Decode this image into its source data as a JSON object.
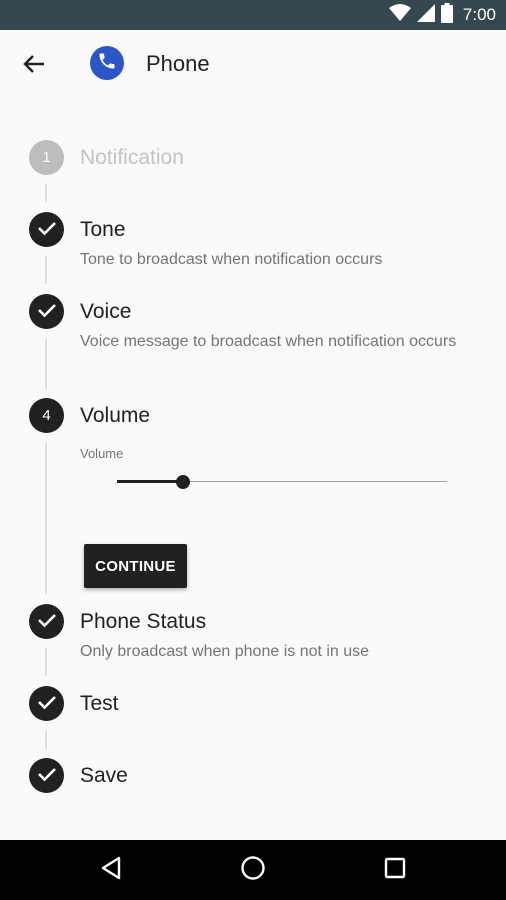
{
  "status_bar": {
    "time": "7:00",
    "icons": [
      "wifi-icon",
      "signal-icon",
      "battery-icon"
    ]
  },
  "app_bar": {
    "title": "Phone",
    "back_icon": "arrow-back-icon",
    "app_icon": "phone-icon"
  },
  "steps": [
    {
      "number": "1",
      "title": "Notification",
      "subtitle": "",
      "state": "disabled"
    },
    {
      "number": "",
      "title": "Tone",
      "subtitle": "Tone to broadcast when notification occurs",
      "state": "done"
    },
    {
      "number": "",
      "title": "Voice",
      "subtitle": "Voice message to broadcast when notification occurs",
      "state": "done"
    },
    {
      "number": "4",
      "title": "Volume",
      "subtitle": "",
      "state": "active"
    },
    {
      "number": "",
      "title": "Phone Status",
      "subtitle": "Only broadcast when phone is not in use",
      "state": "done"
    },
    {
      "number": "",
      "title": "Test",
      "subtitle": "",
      "state": "done"
    },
    {
      "number": "",
      "title": "Save",
      "subtitle": "",
      "state": "done"
    }
  ],
  "volume": {
    "label": "Volume",
    "value_fraction": 0.2
  },
  "continue_label": "CONTINUE",
  "colors": {
    "status_bar": "#37474f",
    "accent": "#212121",
    "app_icon": "#2b56c8",
    "disabled": "#bdbdbd"
  }
}
